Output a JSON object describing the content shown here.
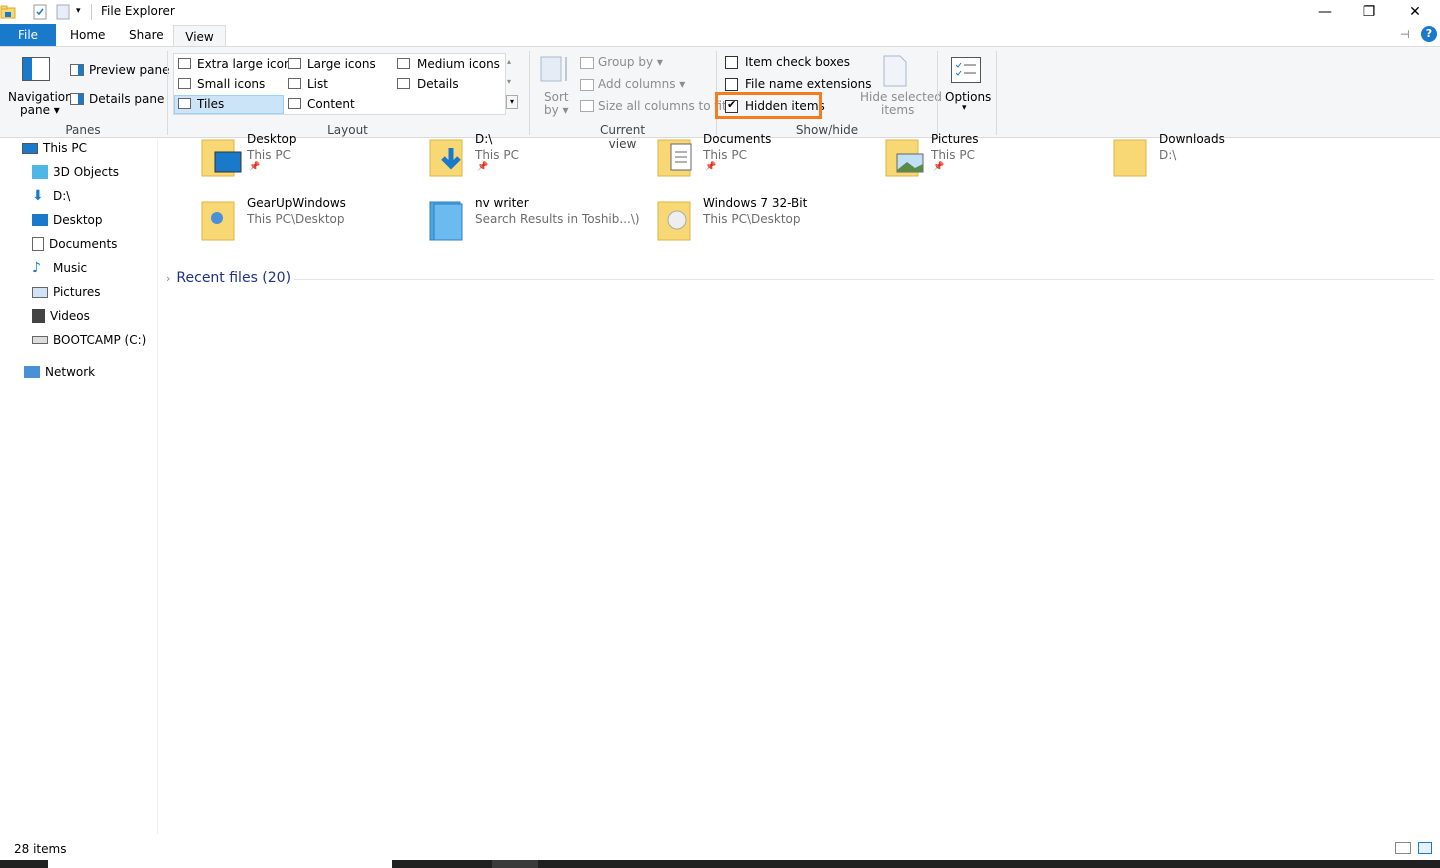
{
  "window": {
    "title": "File Explorer",
    "minimize": "—",
    "maximize": "❐",
    "close": "✕"
  },
  "tabs": {
    "file": "File",
    "home": "Home",
    "share": "Share",
    "view": "View"
  },
  "ribbon": {
    "panes": {
      "label": "Panes",
      "navigation_pane_line1": "Navigation",
      "navigation_pane_line2": "pane ▾",
      "preview_pane": "Preview pane",
      "details_pane": "Details pane"
    },
    "layout": {
      "label": "Layout",
      "items": [
        "Extra large icons",
        "Large icons",
        "Medium icons",
        "Small icons",
        "List",
        "Details",
        "Tiles",
        "Content"
      ],
      "selected": "Tiles"
    },
    "current_view": {
      "label": "Current view",
      "sort_line1": "Sort",
      "sort_line2": "by ▾",
      "group_by": "Group by ▾",
      "add_columns": "Add columns ▾",
      "size_all_columns": "Size all columns to fit"
    },
    "show_hide": {
      "label": "Show/hide",
      "item_check_boxes": "Item check boxes",
      "item_check_boxes_checked": false,
      "file_name_extensions": "File name extensions",
      "file_name_extensions_checked": false,
      "hidden_items": "Hidden items",
      "hidden_items_checked": true,
      "hide_selected_line1": "Hide selected",
      "hide_selected_line2": "items"
    },
    "options": {
      "label": "Options",
      "arrow": "▾"
    }
  },
  "navpane": {
    "items": [
      {
        "label": "This PC",
        "icon": "computer-icon"
      },
      {
        "label": "3D Objects",
        "icon": "cube-icon"
      },
      {
        "label": "D:\\",
        "icon": "download-arrow-icon"
      },
      {
        "label": "Desktop",
        "icon": "desktop-icon"
      },
      {
        "label": "Documents",
        "icon": "document-icon"
      },
      {
        "label": "Music",
        "icon": "music-note-icon"
      },
      {
        "label": "Pictures",
        "icon": "picture-icon"
      },
      {
        "label": "Videos",
        "icon": "film-icon"
      },
      {
        "label": "BOOTCAMP (C:)",
        "icon": "drive-icon"
      },
      {
        "label": "Network",
        "icon": "network-icon"
      }
    ]
  },
  "content": {
    "tiles": [
      {
        "name": "Desktop",
        "sub": "This PC",
        "icon": "folder-desktop-icon",
        "pinned": true
      },
      {
        "name": "D:\\",
        "sub": "This PC",
        "icon": "folder-download-icon",
        "pinned": true
      },
      {
        "name": "Documents",
        "sub": "This PC",
        "icon": "folder-documents-icon",
        "pinned": true
      },
      {
        "name": "Pictures",
        "sub": "This PC",
        "icon": "folder-pictures-icon",
        "pinned": true
      },
      {
        "name": "Downloads",
        "sub": "D:\\",
        "icon": "folder-icon",
        "pinned": false
      },
      {
        "name": "GearUpWindows",
        "sub": "This PC\\Desktop",
        "icon": "folder-gear-icon",
        "pinned": false
      },
      {
        "name": "nv writer",
        "sub": "Search Results in Toshib...\\)",
        "icon": "search-folder-icon",
        "pinned": false
      },
      {
        "name": "Windows 7 32-Bit",
        "sub": "This PC\\Desktop",
        "icon": "folder-disc-icon",
        "pinned": false
      }
    ],
    "recent_files": "Recent files (20)"
  },
  "status": {
    "items_count": "28 items"
  },
  "colors": {
    "accent": "#1979ca",
    "highlight": "#f57c1f",
    "folder": "#f8d775"
  }
}
